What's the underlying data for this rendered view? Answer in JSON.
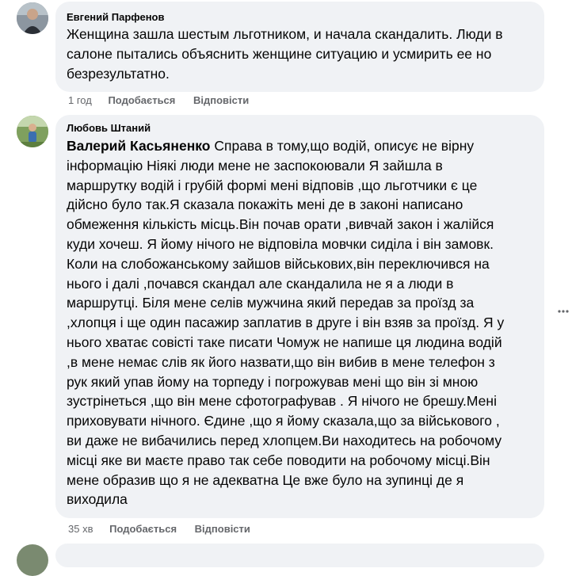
{
  "comments": [
    {
      "author": "Евгений Парфенов",
      "lines": [
        "Женщина зашла шестым льготником, и начала скандалить. Люди в",
        "салоне пытались объяснить женщине ситуацию и усмирить ее но",
        "безрезультатно."
      ],
      "time": "1 год",
      "like_label": "Подобається",
      "reply_label": "Відповісти"
    },
    {
      "author": "Любовь Штаний",
      "mention": "Валерий Касьяненко",
      "first_line_rest": " Справа в тому,що водій, описує не вірну",
      "lines": [
        "інформацію Ніякі люди мене не заспокоювали Я зайшла в",
        "маршрутку водій і грубій формі мені відповів ,що льготчики є це",
        "дійсно було так.Я сказала покажіть мені де в законі написано",
        "обмеження кількість місць.Він почав орати ,вивчай закон і жалійся",
        "куди хочеш. Я йому нічого не відповіла мовчки сиділа і він замовк.",
        "Коли на слобожанському зайшов військових,він переключився на",
        "нього і далі ,почався скандал але скандалила не я а люди в",
        "маршрутці. Біля мене селів мужчина який передав за проїзд за",
        ",хлопця і ще один пасажир заплатив в друге і він взяв за проїзд. Я у",
        "нього хватає совісті таке писати Чомуж не напише ця людина водій",
        ",в мене немає слів як його назвати,що він вибив в мене телефон з",
        "рук який упав йому на торпеду і погрожував мені що він зі мною",
        "зустрінеться ,що він мене сфотографував . Я нічого не брешу.Мені",
        "приховувати нічного. Єдине ,що я йому сказала,що за військового ,",
        "ви даже не вибачились перед хлопцем.Ви находитесь на робочому",
        "місці яке ви маєте право так себе поводити на робочому місці.Він",
        "мене образив що я не адекватна Це вже було на зупинці де я",
        "виходила"
      ],
      "time": "35 хв",
      "like_label": "Подобається",
      "reply_label": "Відповісти"
    }
  ],
  "icons": {
    "more": "more-horizontal-icon"
  }
}
